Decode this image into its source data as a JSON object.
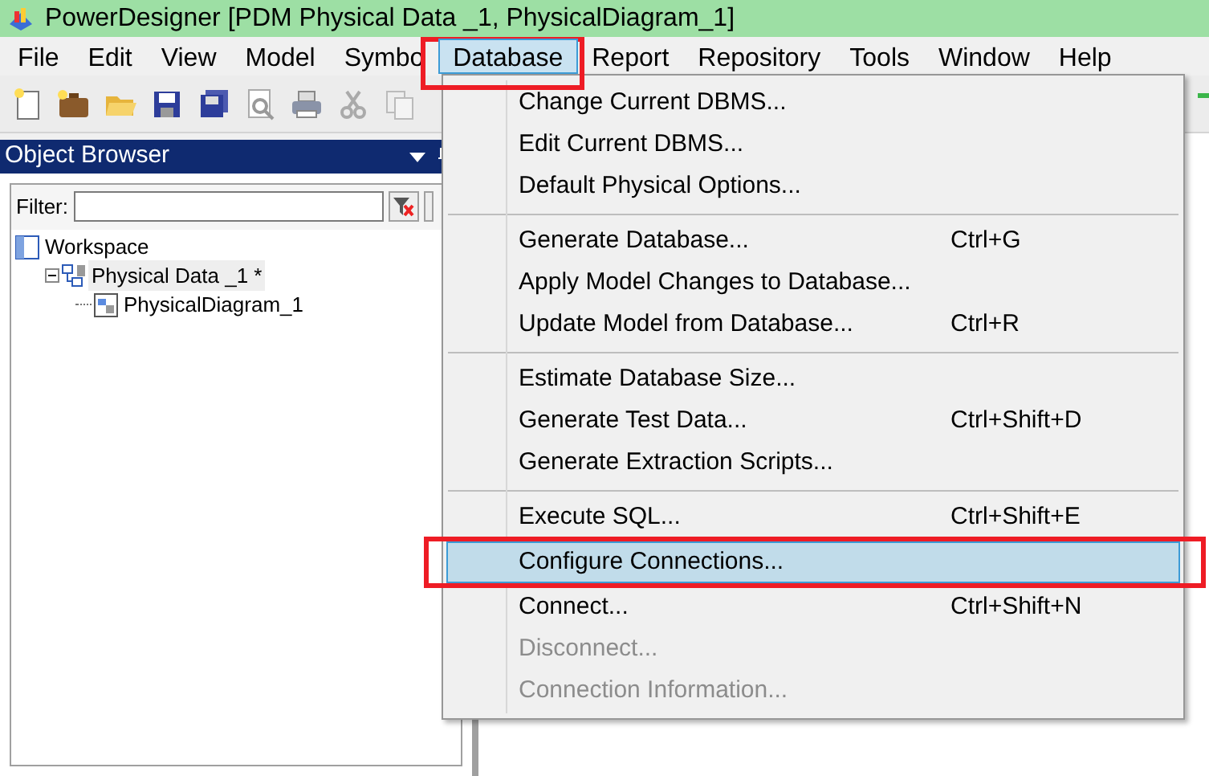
{
  "window": {
    "title": "PowerDesigner [PDM Physical Data _1, PhysicalDiagram_1]"
  },
  "menubar": [
    {
      "label": "File",
      "selected": false
    },
    {
      "label": "Edit",
      "selected": false
    },
    {
      "label": "View",
      "selected": false
    },
    {
      "label": "Model",
      "selected": false
    },
    {
      "label": "Symbo",
      "selected": false
    },
    {
      "label": "Database",
      "selected": true
    },
    {
      "label": "Report",
      "selected": false
    },
    {
      "label": "Repository",
      "selected": false
    },
    {
      "label": "Tools",
      "selected": false
    },
    {
      "label": "Window",
      "selected": false
    },
    {
      "label": "Help",
      "selected": false
    }
  ],
  "object_browser": {
    "title": "Object Browser",
    "filter_label": "Filter:",
    "tree": [
      {
        "label": "Workspace",
        "kind": "workspace",
        "children": [
          {
            "label": "Physical Data _1 *",
            "kind": "model",
            "selected": true,
            "expanded": true,
            "children": [
              {
                "label": "PhysicalDiagram_1",
                "kind": "diagram",
                "selected": false
              }
            ]
          }
        ]
      }
    ]
  },
  "database_menu": [
    {
      "kind": "item",
      "label": "Change Current DBMS...",
      "selected": false,
      "disabled": false
    },
    {
      "kind": "item",
      "label": "Edit Current DBMS...",
      "selected": false,
      "disabled": false
    },
    {
      "kind": "item",
      "label": "Default Physical Options...",
      "selected": false,
      "disabled": false
    },
    {
      "kind": "separator"
    },
    {
      "kind": "item",
      "label": "Generate Database...",
      "shortcut": "Ctrl+G",
      "selected": false,
      "disabled": false
    },
    {
      "kind": "item",
      "label": "Apply Model Changes to Database...",
      "selected": false,
      "disabled": false
    },
    {
      "kind": "item",
      "label": "Update Model from Database...",
      "shortcut": "Ctrl+R",
      "selected": false,
      "disabled": false
    },
    {
      "kind": "separator"
    },
    {
      "kind": "item",
      "label": "Estimate Database Size...",
      "selected": false,
      "disabled": false
    },
    {
      "kind": "item",
      "label": "Generate Test Data...",
      "shortcut": "Ctrl+Shift+D",
      "selected": false,
      "disabled": false
    },
    {
      "kind": "item",
      "label": "Generate Extraction Scripts...",
      "selected": false,
      "disabled": false
    },
    {
      "kind": "separator"
    },
    {
      "kind": "item",
      "label": "Execute SQL...",
      "shortcut": "Ctrl+Shift+E",
      "selected": false,
      "disabled": false
    },
    {
      "kind": "item",
      "label": "Configure Connections...",
      "selected": true,
      "disabled": false
    },
    {
      "kind": "item",
      "label": "Connect...",
      "shortcut": "Ctrl+Shift+N",
      "selected": false,
      "disabled": false
    },
    {
      "kind": "item",
      "label": "Disconnect...",
      "selected": false,
      "disabled": true
    },
    {
      "kind": "item",
      "label": "Connection Information...",
      "selected": false,
      "disabled": true
    }
  ]
}
